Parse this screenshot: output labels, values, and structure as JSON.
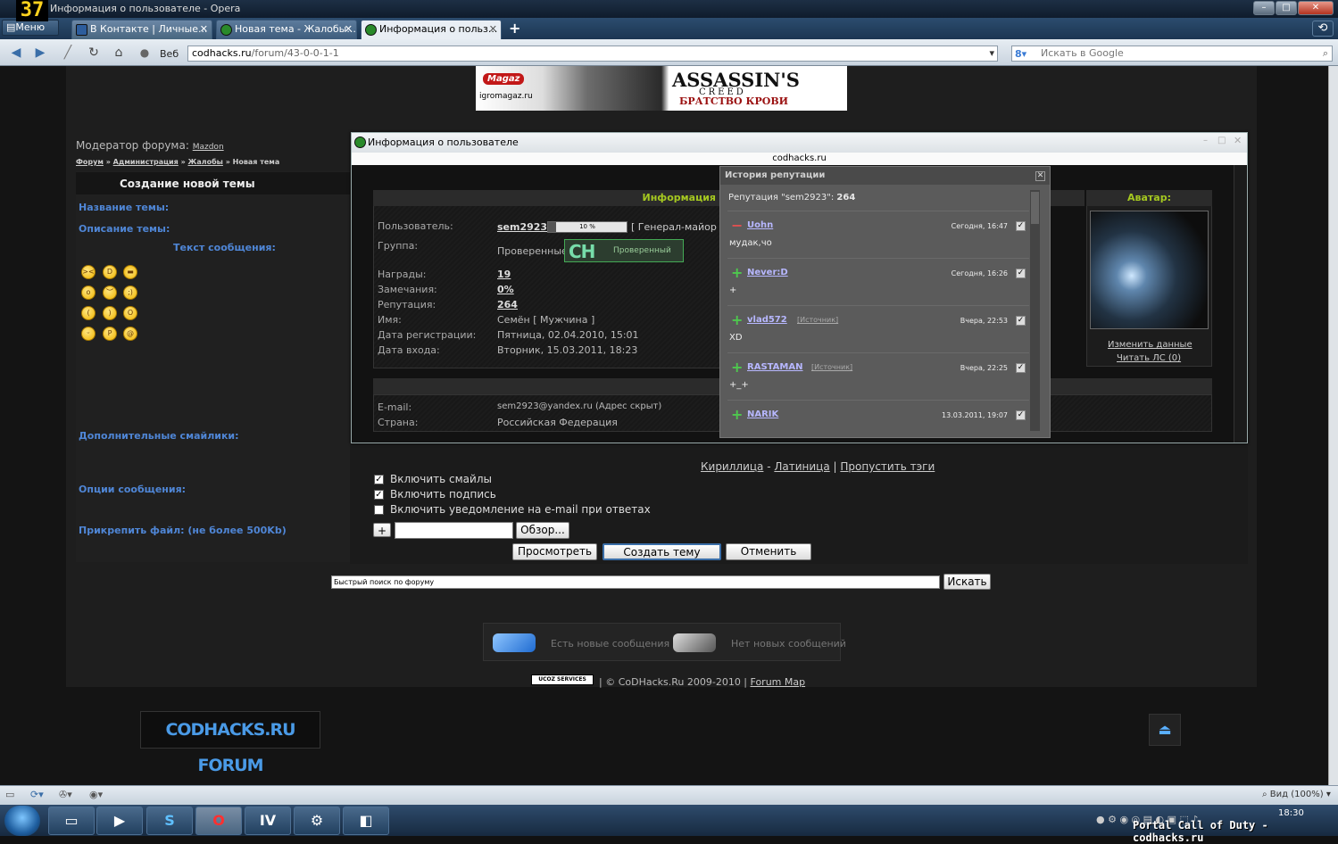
{
  "window": {
    "title": "Информация о пользователе - Opera",
    "logo": "37"
  },
  "tabs": [
    {
      "label": "В Контакте | Личные..."
    },
    {
      "label": "Новая тема - Жалобы..."
    },
    {
      "label": "Информация о польз..."
    }
  ],
  "menu_label": "Меню",
  "address": {
    "scheme_label": "Веб",
    "host": "codhacks.ru",
    "path": "/forum/43-0-0-1-1",
    "search_placeholder": "Искать в Google"
  },
  "banner": {
    "magaz": "Magaz",
    "site": "igromagaz.ru",
    "title": "ASSASSIN'S",
    "subtitle": "CREED",
    "tag": "БРАТСТВО КРОВИ"
  },
  "forum": {
    "moderator_label": "Модератор форума:",
    "moderator_name": "Mazdon",
    "breadcrumb": [
      "Форум",
      "Администрация",
      "Жалобы",
      "Новая тема"
    ],
    "new_topic_header": "Создание новой темы",
    "topic_name_label": "Название темы:",
    "topic_desc_label": "Описание темы:",
    "message_text_label": "Текст сообщения:",
    "extra_smilies_label": "Дополнительные смайлики:",
    "options_label": "Опции сообщения:",
    "attach_label": "Прикрепить файл: (не более 500Kb)",
    "translit": [
      "Кириллица",
      "Латиница",
      "Пропустить тэги"
    ],
    "options": [
      {
        "label": "Включить смайлы",
        "checked": true
      },
      {
        "label": "Включить подпись",
        "checked": true
      },
      {
        "label": "Включить уведомление на e-mail при ответах",
        "checked": false
      }
    ],
    "plus_button": "+",
    "browse_button": "Обзор...",
    "preview_button": "Просмотреть",
    "create_button": "Создать тему",
    "cancel_button": "Отменить",
    "quick_search_placeholder": "Быстрый поиск по форуму",
    "search_button": "Искать",
    "legend_new": "Есть новые сообщения",
    "legend_none": "Нет новых сообщений",
    "ucoz_label": "UCOZ SERVICES",
    "footer_copy": "| © CoDHacks.Ru 2009-2010 |",
    "footer_map": "Forum Map",
    "logo_text": "CODHACKS.RU FORUM"
  },
  "popup": {
    "title": "Информация о пользователе",
    "host": "codhacks.ru",
    "info_header": "Информация",
    "rows": [
      {
        "label": "Пользователь:",
        "value": "sem2923"
      },
      {
        "label": "Группа:",
        "value": "Проверенные"
      },
      {
        "label": "Награды:",
        "value": "19"
      },
      {
        "label": "Замечания:",
        "value": "0%"
      },
      {
        "label": "Репутация:",
        "value": "264"
      },
      {
        "label": "Имя:",
        "value": "Семён [ Мужчина ]"
      },
      {
        "label": "Дата регистрации:",
        "value": "Пятница, 02.04.2010, 15:01"
      },
      {
        "label": "Дата входа:",
        "value": "Вторник, 15.03.2011, 18:23"
      }
    ],
    "progress_text": "10 %",
    "progress": 0.1,
    "rank": "[ Генерал-майор ]",
    "group_badge_ch": "CH",
    "group_badge_label": "Проверенный",
    "email_label": "E-mail:",
    "email_value": "sem2923@yandex.ru (Адрес скрыт)",
    "country_label": "Страна:",
    "country_value": "Российская Федерация",
    "avatar_header": "Аватар:",
    "edit_link": "Изменить данные",
    "read_pm_link": "Читать ЛС (0)"
  },
  "reputation": {
    "title": "История репутации",
    "summary_prefix": "Репутация \"sem2923\": ",
    "summary_value": "264",
    "source_label": "[Источник]",
    "entries": [
      {
        "sign": "−",
        "nick": "Uohn",
        "date": "Сегодня, 16:47",
        "text": "мудак,чо",
        "has_source": false
      },
      {
        "sign": "+",
        "nick": "Never:D",
        "date": "Сегодня, 16:26",
        "text": "+",
        "has_source": false
      },
      {
        "sign": "+",
        "nick": "vlad572",
        "date": "Вчера, 22:53",
        "text": "XD",
        "has_source": true
      },
      {
        "sign": "+",
        "nick": "RASTAMAN",
        "date": "Вчера, 22:25",
        "text": "+_+",
        "has_source": true
      },
      {
        "sign": "+",
        "nick": "NARIK",
        "date": "13.03.2011, 19:07",
        "text": "",
        "has_source": false
      }
    ]
  },
  "statusbar": {
    "zoom": "Вид (100%)"
  },
  "taskbar": {
    "clock": "18:30",
    "watermark": "Portal Call of Duty - codhacks.ru"
  },
  "colors": {
    "accent_green": "#a5c820",
    "link_blue": "#4f86d6",
    "minus": "#e05050",
    "plus": "#4ec84e"
  }
}
